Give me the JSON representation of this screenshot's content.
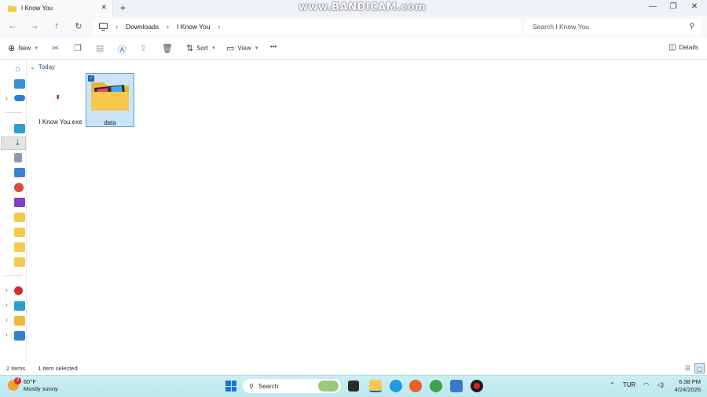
{
  "window": {
    "tab_title": "I Know You",
    "new_tab": "+",
    "watermark": "www.BANDICAM.com",
    "controls": {
      "minimize": "—",
      "maximize": "❐",
      "close": "✕"
    }
  },
  "navigation": {
    "back": "←",
    "forward": "→",
    "up": "↑",
    "refresh": "↻",
    "breadcrumb": [
      "Downloads",
      "I Know You"
    ],
    "search_placeholder": "Search I Know You"
  },
  "toolbar": {
    "new_label": "New",
    "sort_label": "Sort",
    "view_label": "View",
    "more": "•••",
    "details_label": "Details"
  },
  "content": {
    "group_label": "Today",
    "items": [
      {
        "name": "I Know You.exe",
        "icon": "exe-icon",
        "selected": false
      },
      {
        "name": "data",
        "icon": "folder-icon",
        "selected": true
      }
    ]
  },
  "status": {
    "item_count": "2 items",
    "selection": "1 item selected"
  },
  "taskbar": {
    "temperature": "60°F",
    "weather": "Mostly sunny",
    "weather_badge": "2",
    "search_label": "Search",
    "language": "TUR",
    "time": "6:38 PM",
    "date": "4/24/2026"
  },
  "colors": {
    "accent": "#1a67c3",
    "selection_bg": "#cce4f7",
    "taskbar_bg": "#c4ebf0",
    "folder": "#f6c94c"
  }
}
